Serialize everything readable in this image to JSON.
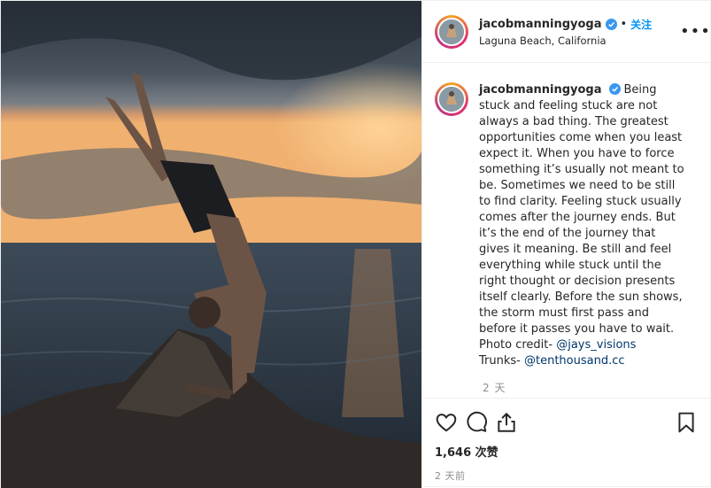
{
  "post": {
    "username": "jacobmanningyoga",
    "follow_label": "关注",
    "separator": "•",
    "location": "Laguna Beach, California",
    "more_icon": "more-horizontal-icon"
  },
  "caption": {
    "username": "jacobmanningyoga",
    "text": "Being stuck and feeling stuck are not always a bad thing. The greatest opportunities come when you least expect it. When you have to force something it’s usually not meant to be. Sometimes we need to be still to find clarity. Feeling stuck usually comes after the journey ends. But it’s the end of the journey that gives it meaning. Be still and feel everything while stuck until the right thought or decision presents itself clearly. Before the sun shows, the storm must first pass and before it passes you have to wait.",
    "photo_credit_label": "Photo credit- ",
    "photo_credit_handle": "@jays_visions",
    "trunks_label": "Trunks- ",
    "trunks_handle": "@tenthousand.cc",
    "time": "2 天"
  },
  "actions": {
    "icons": [
      "heart-icon",
      "comment-icon",
      "share-icon",
      "bookmark-icon"
    ],
    "likes": "1,646 次赞",
    "time_ago": "2 天前"
  },
  "colors": {
    "link": "#0095f6",
    "mention": "#00376b",
    "muted": "#8e8e8e",
    "verified": "#3897f0"
  }
}
